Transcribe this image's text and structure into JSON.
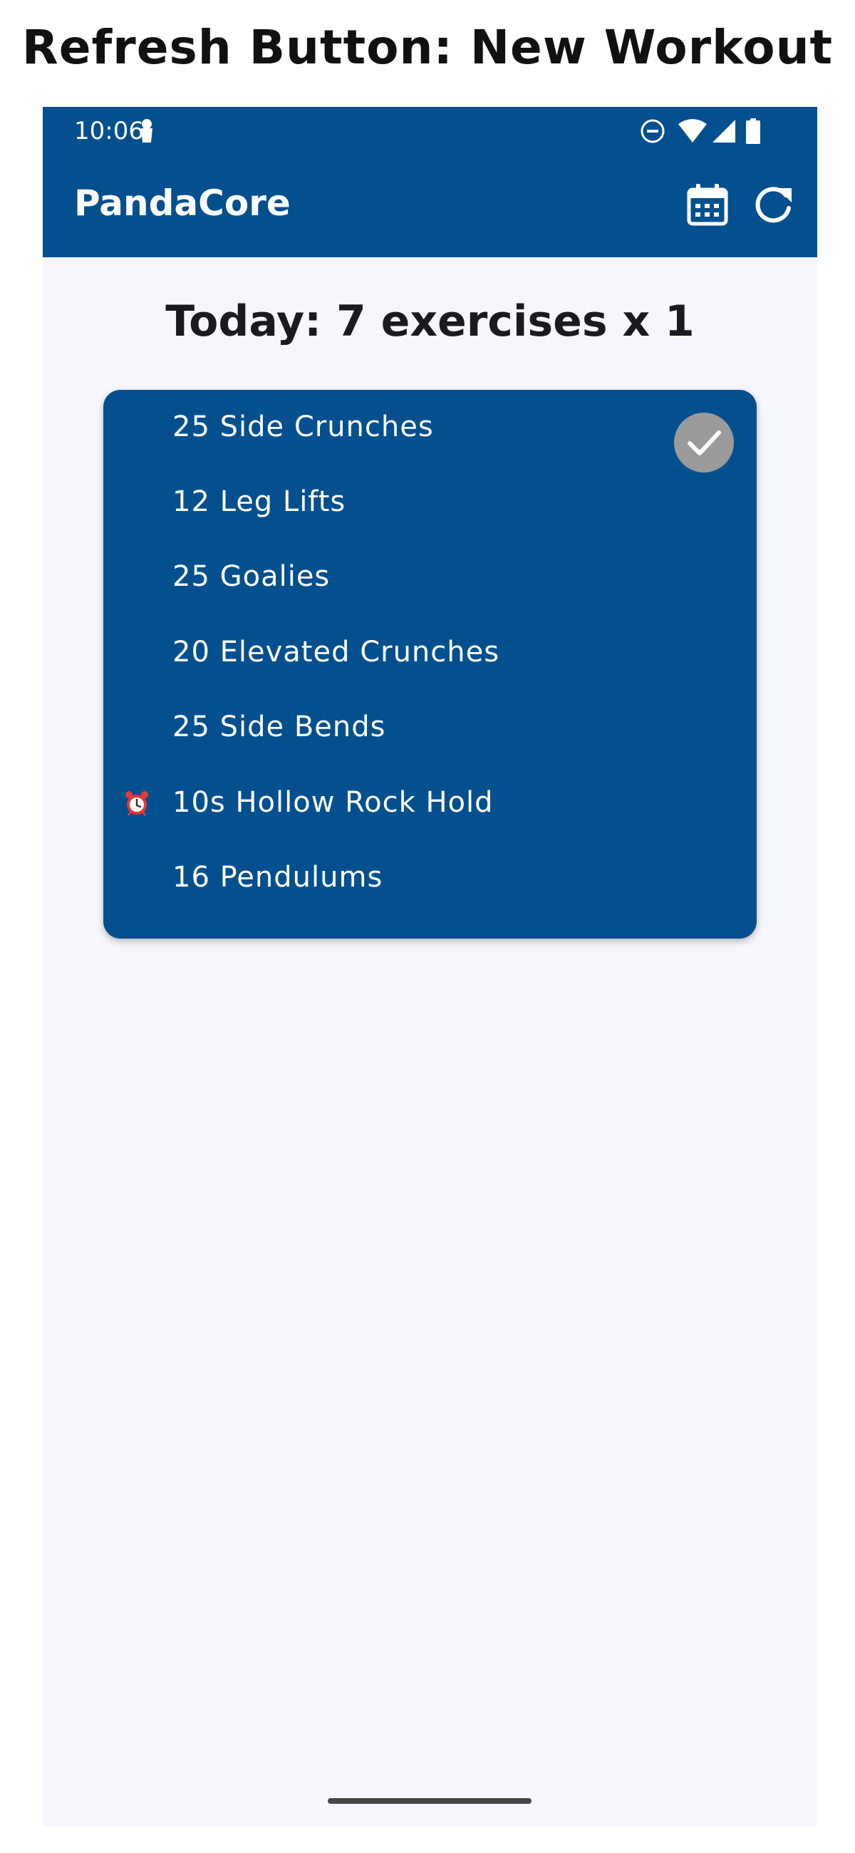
{
  "caption": "Refresh Button: New Workout",
  "status_bar": {
    "time": "10:06",
    "icons": [
      "notification-icon",
      "dnd-icon",
      "wifi-icon",
      "signal-icon",
      "battery-icon"
    ]
  },
  "app_bar": {
    "title": "PandaCore",
    "actions": [
      "calendar-icon",
      "refresh-icon"
    ]
  },
  "heading": "Today: 7 exercises x 1",
  "exercises": [
    {
      "label": "25 Side Crunches",
      "completed": true,
      "timed": false
    },
    {
      "label": "12 Leg Lifts",
      "completed": false,
      "timed": false
    },
    {
      "label": "25 Goalies",
      "completed": false,
      "timed": false
    },
    {
      "label": "20 Elevated Crunches",
      "completed": false,
      "timed": false
    },
    {
      "label": "25 Side Bends",
      "completed": false,
      "timed": false
    },
    {
      "label": "10s Hollow Rock Hold",
      "completed": false,
      "timed": true,
      "icon": "alarm-clock-icon"
    },
    {
      "label": "16 Pendulums",
      "completed": false,
      "timed": false
    }
  ],
  "colors": {
    "primary": "#04508F",
    "background": "#F6F7FD",
    "check_badge": "#9A9A9A"
  }
}
